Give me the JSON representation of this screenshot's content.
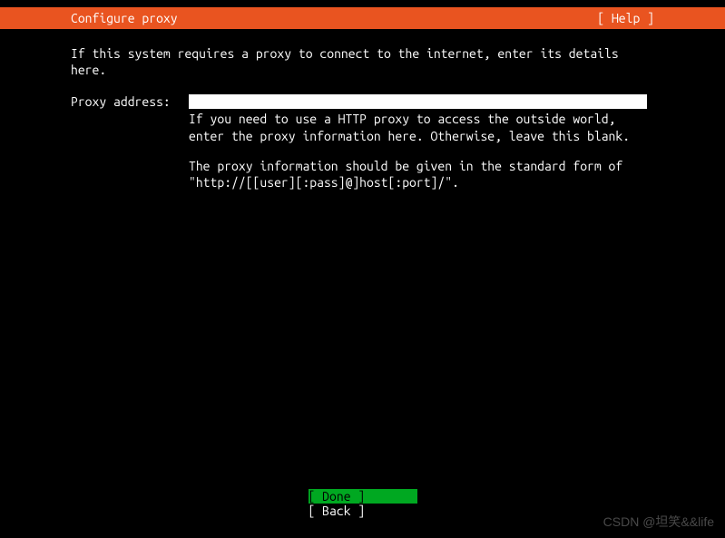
{
  "header": {
    "title": "Configure proxy",
    "help": "[ Help ]"
  },
  "intro": "If this system requires a proxy to connect to the internet, enter its details here.",
  "form": {
    "label": "Proxy address:",
    "value": "",
    "hint1": "If you need to use a HTTP proxy to access the outside world, enter the proxy information here. Otherwise, leave this blank.",
    "hint2": "The proxy information should be given in the standard form of \"http://[[user][:pass]@]host[:port]/\"."
  },
  "footer": {
    "done": "[ Done       ]",
    "back": "[ Back       ]"
  },
  "watermark": "CSDN @坦笑&&life"
}
